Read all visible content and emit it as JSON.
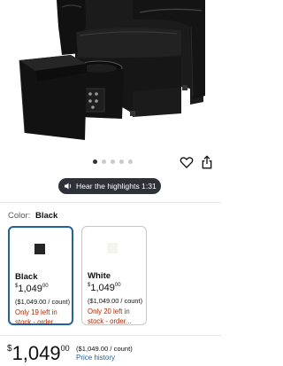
{
  "carousel": {
    "dot_count": 5,
    "active_index": 0
  },
  "highlights": {
    "label": "Hear the highlights 1:31"
  },
  "color": {
    "label": "Color:",
    "selected": "Black"
  },
  "swatches": [
    {
      "name": "Black",
      "price_dollars": "1,049",
      "price_cents": "00",
      "price_symbol": "$",
      "unit": "($1,049.00 / count)",
      "stock": "Only 19 left in stock - order...",
      "thumb_color": "#262626"
    },
    {
      "name": "White",
      "price_dollars": "1,049",
      "price_cents": "00",
      "price_symbol": "$",
      "unit": "($1,049.00 / count)",
      "stock": "Only 20 left in stock - order...",
      "thumb_color": "#f4f4f0"
    }
  ],
  "price": {
    "symbol": "$",
    "whole": "1,049",
    "cents": "00",
    "per_count": "($1,049.00 / count)",
    "history_link": "Price history"
  },
  "colors": {
    "accent": "#2162a1",
    "stock_red": "#b12704",
    "dark_pill": "#2f3138"
  }
}
